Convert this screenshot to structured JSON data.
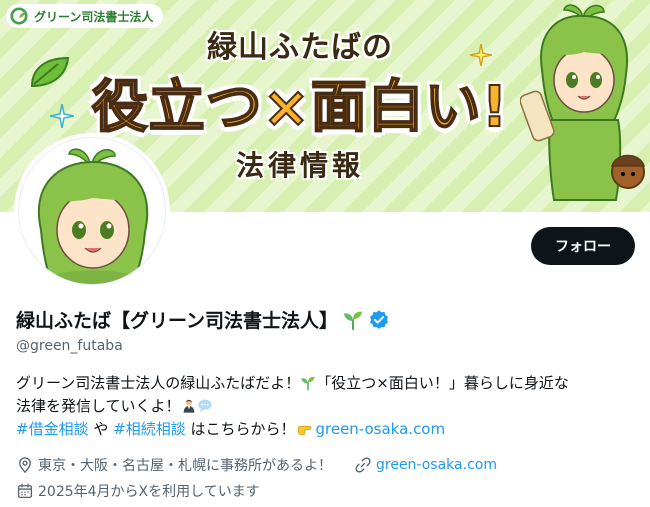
{
  "banner": {
    "brand": "グリーン司法書士法人",
    "title_small": "緑山ふたばの",
    "title_big": "役立つ×面白い!",
    "title_sub": "法律情報"
  },
  "follow_label": "フォロー",
  "profile": {
    "display_name": "緑山ふたば【グリーン司法書士法人】",
    "handle": "@green_futaba",
    "name_icons": [
      "sprout-icon",
      "verified-badge-icon"
    ]
  },
  "bio": {
    "line1_text": "グリーン司法書士法人の緑山ふたばだよ！",
    "line1_after_sprout": "「役立つ×面白い！」暮らしに身近な",
    "line2_text": "法律を発信していくよ！",
    "line2_icons": [
      "lawyer-icon",
      "speech-bubble-icon"
    ],
    "hashtag1": "#借金相談",
    "joiner": " や ",
    "hashtag2": "#相続相談",
    "line3_text": " はこちらから！",
    "line3_icon": "pointing-hand-icon",
    "link": "green-osaka.com"
  },
  "meta": {
    "location": "東京・大阪・名古屋・札幌に事務所があるよ！",
    "website": "green-osaka.com",
    "joined": "2025年4月からXを利用しています"
  },
  "colors": {
    "accent": "#1d9bf0",
    "follow_bg": "#0f1419",
    "secondary_text": "#536471",
    "banner_green": "#d8efb2",
    "title_yellow": "#f7b32b"
  }
}
